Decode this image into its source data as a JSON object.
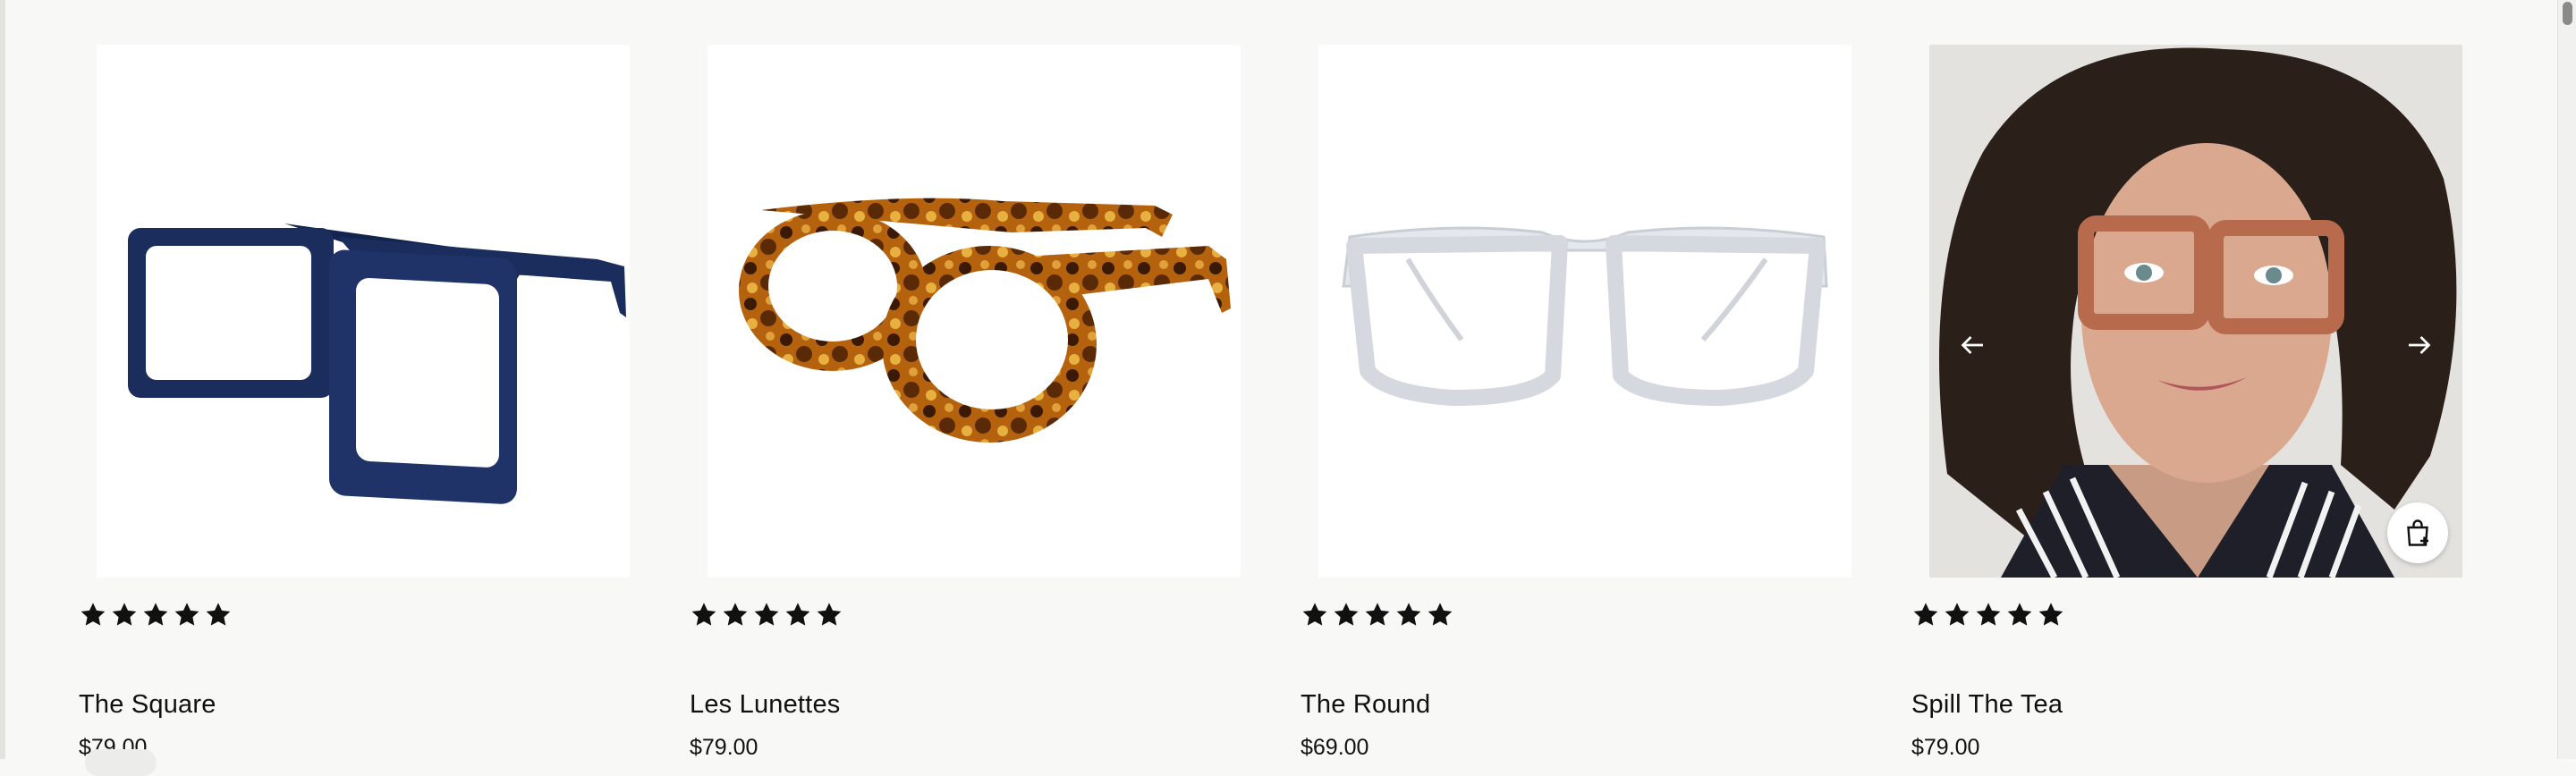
{
  "products": [
    {
      "title": "The Square",
      "price": "$79.00",
      "rating": 5,
      "image_icon": "square-glasses-navy-icon"
    },
    {
      "title": "Les Lunettes",
      "price": "$79.00",
      "rating": 5,
      "image_icon": "cateye-glasses-tortoise-icon"
    },
    {
      "title": "The Round",
      "price": "$69.00",
      "rating": 5,
      "image_icon": "round-glasses-clear-icon"
    },
    {
      "title": "Spill The Tea",
      "price": "$79.00",
      "rating": 5,
      "image_icon": "model-photo-icon"
    }
  ],
  "colors": {
    "background": "#f8f8f6",
    "star": "#111111",
    "navy_frame": "#1a2d5c",
    "tortoise_frame": "#9a4d12",
    "clear_frame": "#dfe3e8",
    "tea_frame": "#b86a4c"
  }
}
